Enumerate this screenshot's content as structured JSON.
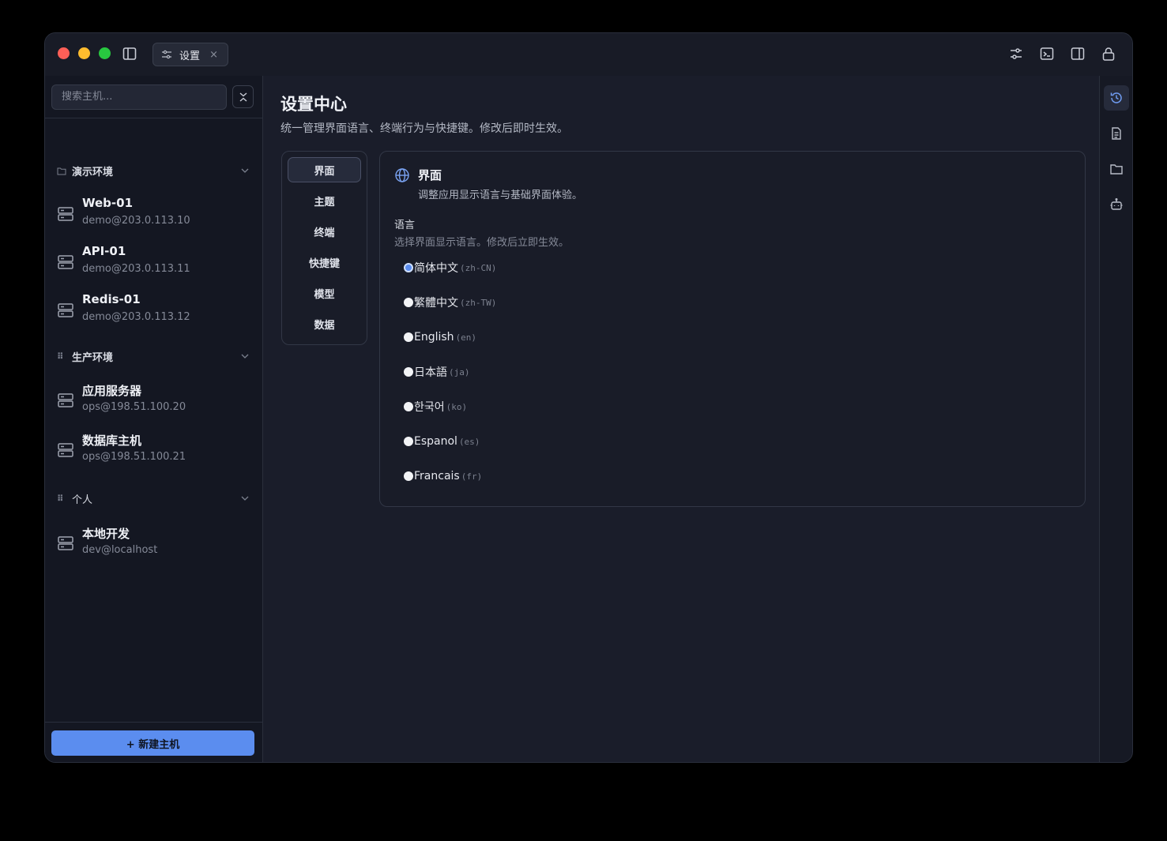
{
  "titlebar": {
    "tab_label": "设置",
    "tab_close": "×"
  },
  "sidebar": {
    "search_placeholder": "搜索主机...",
    "groups": [
      {
        "label": "演示环境",
        "hosts": [
          {
            "name": "Web-01",
            "addr": "demo@203.0.113.10"
          },
          {
            "name": "API-01",
            "addr": "demo@203.0.113.11"
          },
          {
            "name": "Redis-01",
            "addr": "demo@203.0.113.12"
          }
        ]
      },
      {
        "label": "生产环境",
        "hosts": [
          {
            "name": "应用服务器",
            "addr": "ops@198.51.100.20"
          },
          {
            "name": "数据库主机",
            "addr": "ops@198.51.100.21"
          }
        ]
      },
      {
        "label": "个人",
        "hosts": [
          {
            "name": "本地开发",
            "addr": "dev@localhost"
          }
        ]
      }
    ],
    "new_host_label": "+ 新建主机"
  },
  "main": {
    "title": "设置中心",
    "subtitle": "统一管理界面语言、终端行为与快捷键。修改后即时生效。",
    "nav": [
      "界面",
      "主题",
      "终端",
      "快捷键",
      "模型",
      "数据"
    ],
    "nav_active": "界面",
    "panel": {
      "title": "界面",
      "desc": "调整应用显示语言与基础界面体验。",
      "section_label": "语言",
      "section_hint": "选择界面显示语言。修改后立即生效。",
      "options": [
        {
          "name": "简体中文",
          "code": "(zh-CN)",
          "selected": true
        },
        {
          "name": "繁體中文",
          "code": "(zh-TW)",
          "selected": false
        },
        {
          "name": "English",
          "code": "(en)",
          "selected": false
        },
        {
          "name": "日本語",
          "code": "(ja)",
          "selected": false
        },
        {
          "name": "한국어",
          "code": "(ko)",
          "selected": false
        },
        {
          "name": "Espanol",
          "code": "(es)",
          "selected": false
        },
        {
          "name": "Francais",
          "code": "(fr)",
          "selected": false
        }
      ]
    }
  },
  "icons": {
    "titlebar_right": [
      "sliders-icon",
      "terminal-icon",
      "split-panel-icon",
      "lock-icon"
    ],
    "rightbar": [
      "history-icon",
      "document-icon",
      "folder-icon",
      "robot-icon"
    ]
  },
  "colors": {
    "accent": "#5b8def",
    "window_bg": "#151823",
    "main_bg": "#1a1d2a"
  }
}
